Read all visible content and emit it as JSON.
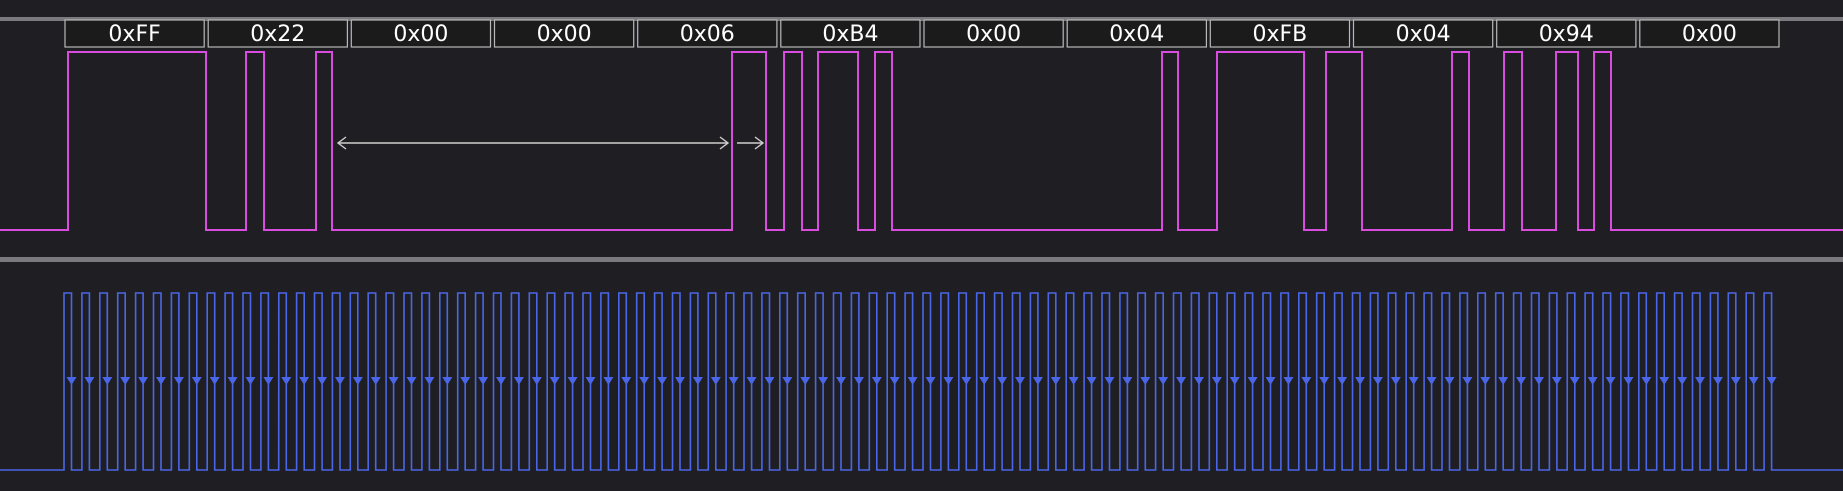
{
  "colors": {
    "background": "#1f1f23",
    "data_channel": "#d84de0",
    "clock_channel": "#4a66e8",
    "marker": "#cfcfcf"
  },
  "decoded_bytes": [
    "0xFF",
    "0x22",
    "0x00",
    "0x00",
    "0x06",
    "0xB4",
    "0x00",
    "0x04",
    "0xFB",
    "0x04",
    "0x94",
    "0x00"
  ],
  "channels": [
    {
      "name": "data-channel",
      "icon": "none"
    },
    {
      "name": "clock-channel",
      "icon": "none"
    }
  ],
  "clock": {
    "pulses": 96,
    "edge_marker": "falling-edge-arrow"
  },
  "timing_marker": {
    "arrows": 2
  }
}
